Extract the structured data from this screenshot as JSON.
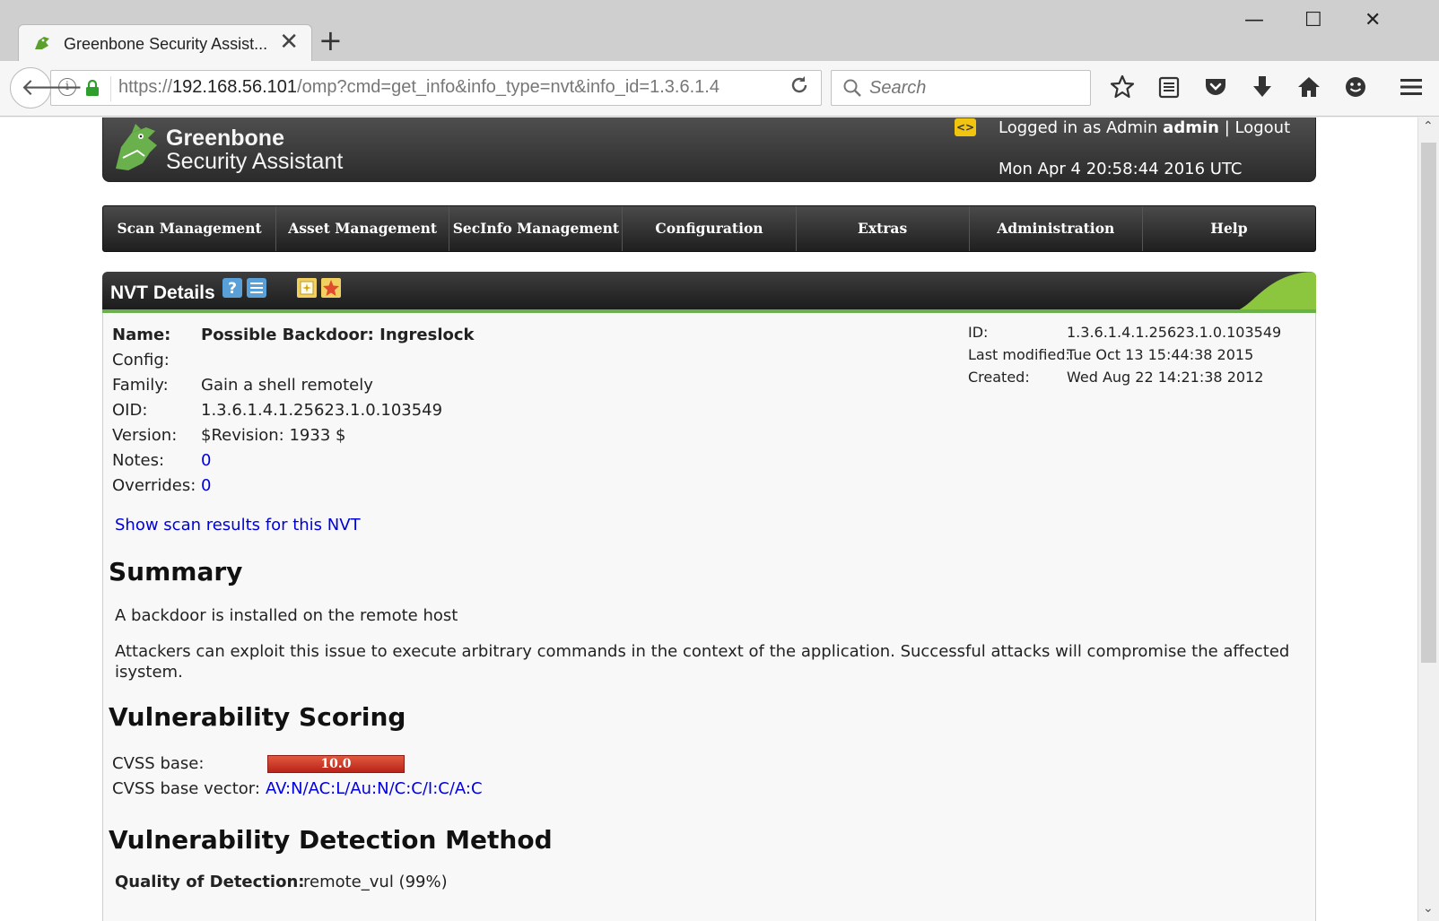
{
  "browser": {
    "tab_title": "Greenbone Security Assist...",
    "tab_close": "✕",
    "new_tab": "+",
    "url_prefix": "https://",
    "url_host": "192.168.56.101",
    "url_path": "/omp?cmd=get_info&info_type=nvt&info_id=1.3.6.1.4",
    "search_placeholder": "Search",
    "window_controls": {
      "minimize": "—",
      "maximize": "☐",
      "close": "✕"
    }
  },
  "gsa_header": {
    "brand_line1": "Greenbone",
    "brand_line2": "Security Assistant",
    "lang_icon": "<>",
    "logged_in_prefix": "Logged in as Admin",
    "user": "admin",
    "separator": "|",
    "logout": "Logout",
    "datetime": "Mon Apr 4 20:58:44 2016 UTC"
  },
  "menu": [
    "Scan Management",
    "Asset Management",
    "SecInfo Management",
    "Configuration",
    "Extras",
    "Administration",
    "Help"
  ],
  "section": {
    "title": "NVT Details",
    "icons": [
      "help-icon",
      "list-icon",
      "new-note-icon",
      "new-override-icon"
    ]
  },
  "details": {
    "name_label": "Name:",
    "name": "Possible Backdoor: Ingreslock",
    "config_label": "Config:",
    "config": "",
    "family_label": "Family:",
    "family": "Gain a shell remotely",
    "oid_label": "OID:",
    "oid": "1.3.6.1.4.1.25623.1.0.103549",
    "version_label": "Version:",
    "version": "$Revision: 1933 $",
    "notes_label": "Notes:",
    "notes": "0",
    "overrides_label": "Overrides:",
    "overrides": "0",
    "id_label": "ID:",
    "id": "1.3.6.1.4.1.25623.1.0.103549",
    "modified_label": "Last modified:",
    "modified": "Tue Oct 13 15:44:38 2015",
    "created_label": "Created:",
    "created": "Wed Aug 22 14:21:38 2012",
    "scan_results_link": "Show scan results for this NVT"
  },
  "summary": {
    "heading": "Summary",
    "line1": "A backdoor is installed on the remote host",
    "line2": "Attackers can exploit this issue to execute arbitrary commands in the context of the application. Successful attacks will compromise the affected isystem."
  },
  "scoring": {
    "heading": "Vulnerability Scoring",
    "cvss_label": "CVSS base:",
    "cvss_value": "10.0",
    "cvss_fraction": 1.0,
    "vector_label": "CVSS base vector:",
    "vector": "AV:N/AC:L/Au:N/C:C/I:C/A:C",
    "bar_color": "#c93a26"
  },
  "detection": {
    "heading": "Vulnerability Detection Method",
    "qod_label": "Quality of Detection:",
    "qod": "remote_vul (99%)"
  }
}
